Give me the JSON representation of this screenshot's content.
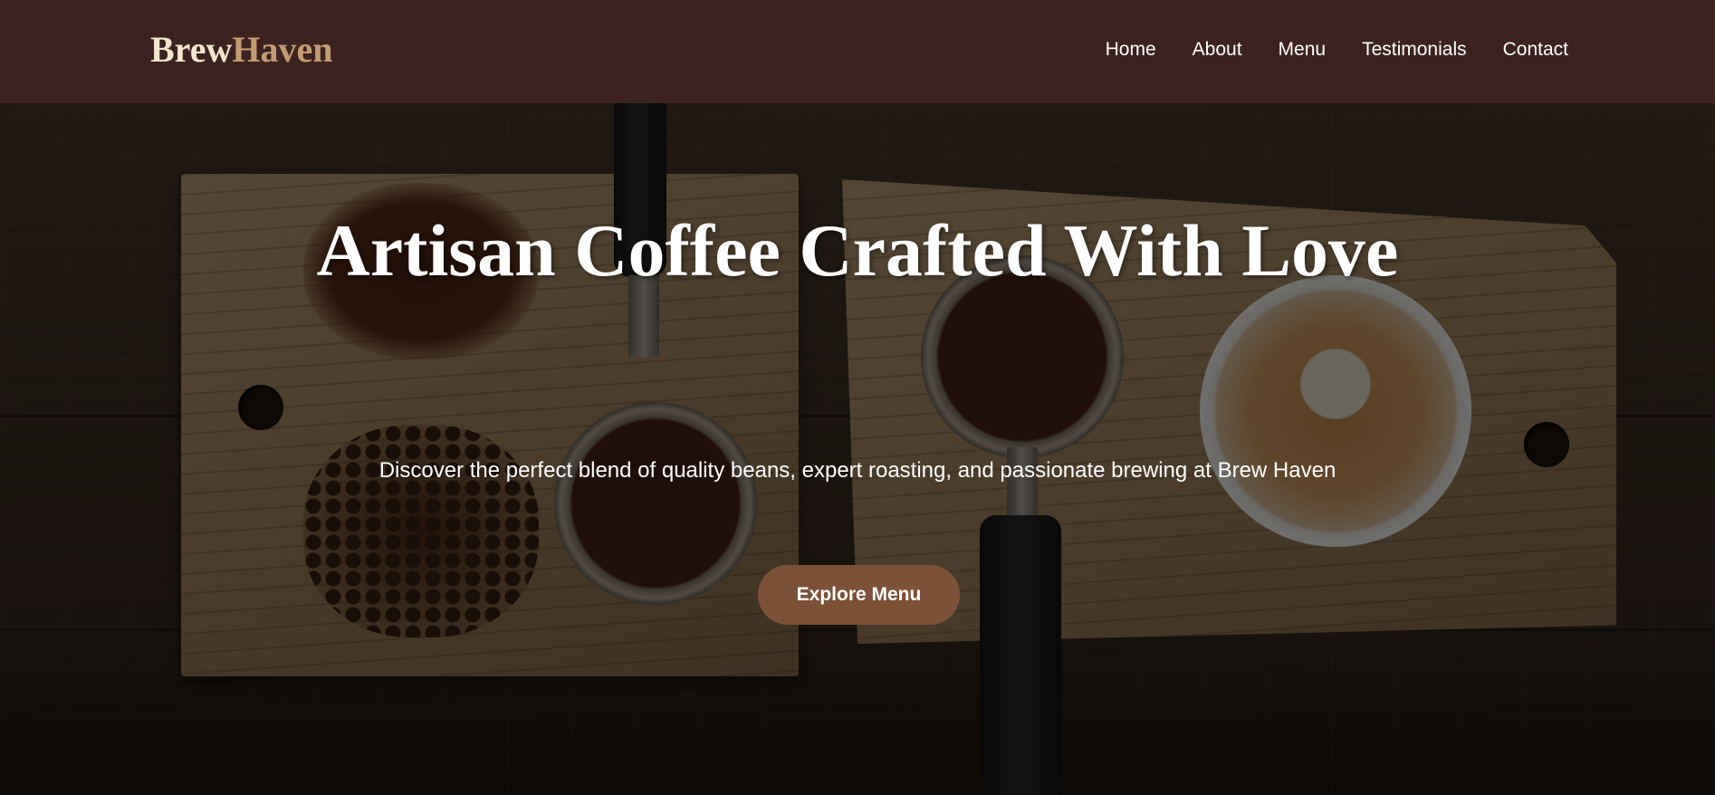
{
  "brand": {
    "part1": "Brew",
    "part2": "Haven"
  },
  "nav": {
    "items": [
      {
        "label": "Home"
      },
      {
        "label": "About"
      },
      {
        "label": "Menu"
      },
      {
        "label": "Testimonials"
      },
      {
        "label": "Contact"
      }
    ]
  },
  "hero": {
    "title": "Artisan Coffee Crafted With Love",
    "subtitle": "Discover the perfect blend of quality beans, expert roasting, and passionate brewing at Brew Haven",
    "cta_label": "Explore Menu",
    "background_image": "coffee-boards-background"
  },
  "colors": {
    "navbar_bg": "#3c2320",
    "logo_primary": "#f3e6cf",
    "logo_accent": "#c39b73",
    "cta_bg": "#7b5238",
    "text": "#ffffff"
  }
}
